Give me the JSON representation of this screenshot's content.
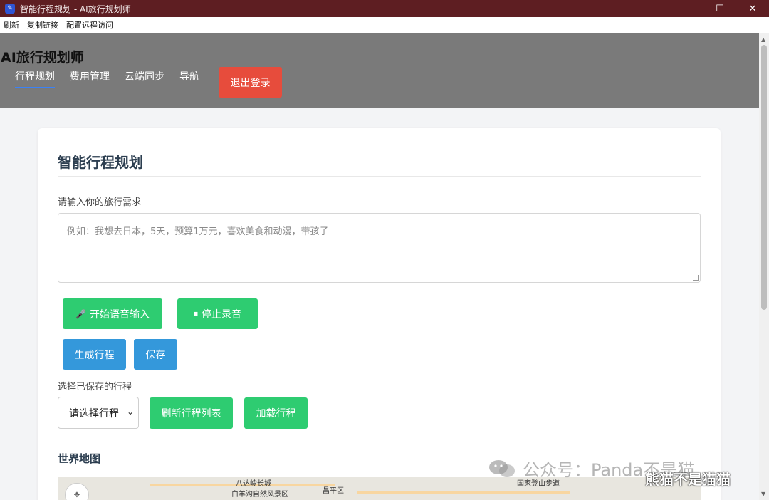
{
  "window": {
    "title": "智能行程规划 - AI旅行规划师",
    "controls": {
      "minimize": "—",
      "maximize": "☐",
      "close": "✕"
    }
  },
  "menubar": [
    "刷新",
    "复制链接",
    "配置远程访问"
  ],
  "header": {
    "brand": "AI旅行规划师",
    "nav": [
      "行程规划",
      "费用管理",
      "云端同步",
      "导航"
    ],
    "active_nav": "行程规划",
    "logout": "退出登录"
  },
  "main": {
    "title": "智能行程规划",
    "request_label": "请输入你的旅行需求",
    "request_placeholder": "例如：我想去日本，5天，预算1万元，喜欢美食和动漫，带孩子",
    "voice_start": "开始语音输入",
    "voice_stop": "停止录音",
    "generate": "生成行程",
    "save": "保存",
    "saved_label": "选择已保存的行程",
    "select_value": "请选择行程",
    "refresh_list": "刷新行程列表",
    "load": "加载行程",
    "map_title": "世界地图",
    "map_labels": [
      "八达岭长城",
      "白羊沟自然风景区",
      "昌平区",
      "国家登山步道"
    ]
  },
  "watermark": {
    "text": "公众号：Panda不是猫",
    "overlay": "熊猫不是猫猫"
  },
  "colors": {
    "titlebar": "#5e1e22",
    "header": "#7a7a7a",
    "logout": "#e74c3c",
    "green": "#2ecc71",
    "blue": "#3498db",
    "nav_underline": "#3b82f6"
  }
}
